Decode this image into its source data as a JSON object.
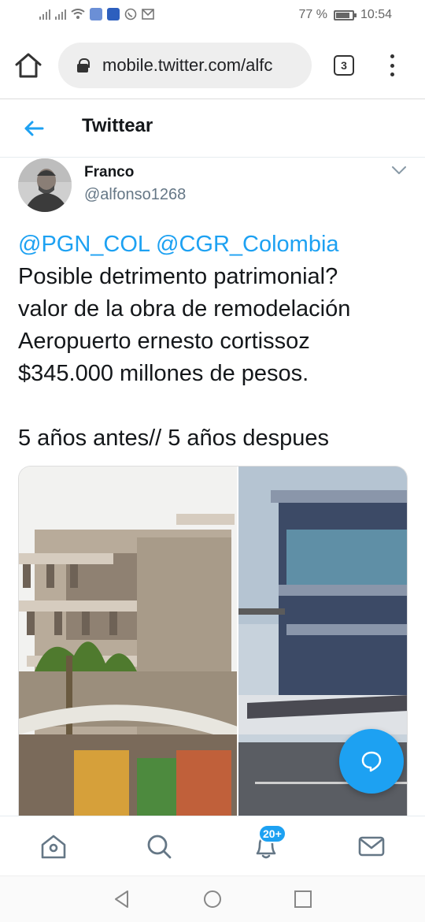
{
  "status_bar": {
    "battery_percent": "77 %",
    "time": "10:54"
  },
  "browser": {
    "url": "mobile.twitter.com/alfc",
    "tab_count": "3"
  },
  "twitter": {
    "page_title": "Twittear"
  },
  "tweet": {
    "author_name": "Franco",
    "author_handle": "@alfonso1268",
    "mention_1": "@PGN_COL",
    "mention_2": "@CGR_Colombia",
    "text_line_1": "Posible detrimento patrimonial?",
    "text_line_2": "valor de la obra de remodelación",
    "text_line_3": "Aeropuerto ernesto cortissoz",
    "text_line_4": "$345.000 millones de pesos.",
    "text_line_5": "5 años antes// 5 años despues"
  },
  "bottom_nav": {
    "notifications_badge": "20+",
    "items": [
      "home-icon",
      "search-icon",
      "notifications-icon",
      "messages-icon"
    ]
  },
  "colors": {
    "accent": "#1da1f2",
    "text": "#14171a",
    "muted": "#657786"
  }
}
